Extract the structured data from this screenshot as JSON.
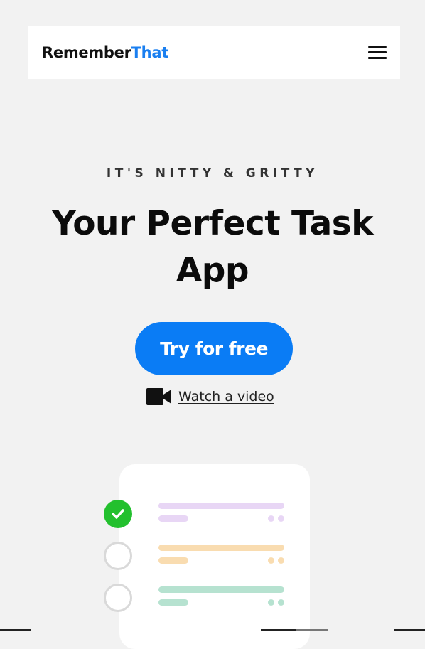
{
  "header": {
    "logo_main": "Remember",
    "logo_accent": "That",
    "menu_icon": "hamburger-menu-icon"
  },
  "hero": {
    "eyebrow": "IT'S NITTY & GRITTY",
    "headline": "Your Perfect Task App",
    "cta_label": "Try for free",
    "video_label": "Watch a video",
    "video_icon": "video-camera-icon"
  },
  "illustration": {
    "tasks": [
      {
        "status": "done",
        "color": "#e8d6f5"
      },
      {
        "status": "open",
        "color": "#f9dcb0"
      },
      {
        "status": "open",
        "color": "#b6e2d0"
      }
    ]
  },
  "colors": {
    "accent": "#1a7ff0",
    "cta_background": "#0a7cf5",
    "check_green": "#23c02e",
    "page_background": "#f2f2f2"
  }
}
